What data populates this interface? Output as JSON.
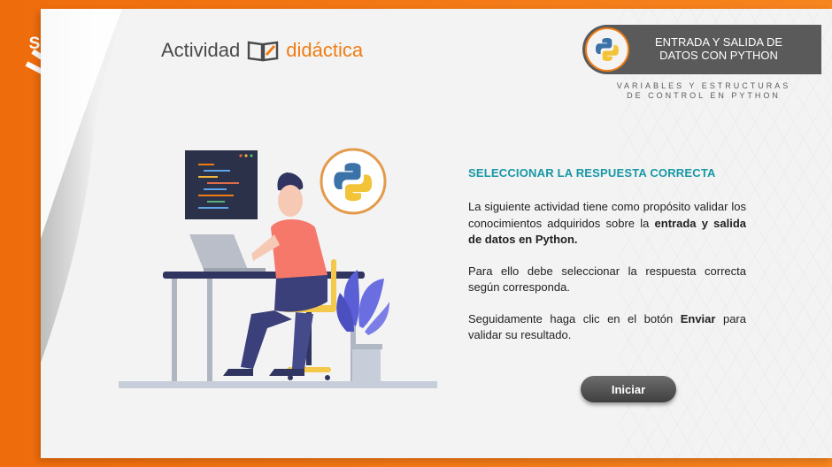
{
  "brand": {
    "logo_text": "SENA"
  },
  "header": {
    "activity_word1": "Actividad",
    "activity_word2": "didáctica",
    "badge_line1": "ENTRADA Y SALIDA DE",
    "badge_line2": "DATOS CON PYTHON",
    "subtitle_line1": "VARIABLES Y ESTRUCTURAS",
    "subtitle_line2": "DE CONTROL EN PYTHON"
  },
  "main": {
    "heading": "SELECCIONAR LA RESPUESTA CORRECTA",
    "p1_text": "La siguiente actividad tiene como propósito validar los conocimientos adquiridos sobre la ",
    "p1_bold": "entrada y salida de datos en Python.",
    "p2_text": "Para ello debe seleccionar la respuesta correcta según corresponda.",
    "p3_text_a": "Seguidamente haga clic en el botón ",
    "p3_bold": "Enviar",
    "p3_text_b": " para validar su resultado.",
    "start_button": "Iniciar"
  },
  "icons": {
    "python": "python-icon",
    "book": "book-icon"
  },
  "colors": {
    "orange": "#f07d14",
    "teal_heading": "#1797a6",
    "badge_gray": "#5a5a5a"
  }
}
